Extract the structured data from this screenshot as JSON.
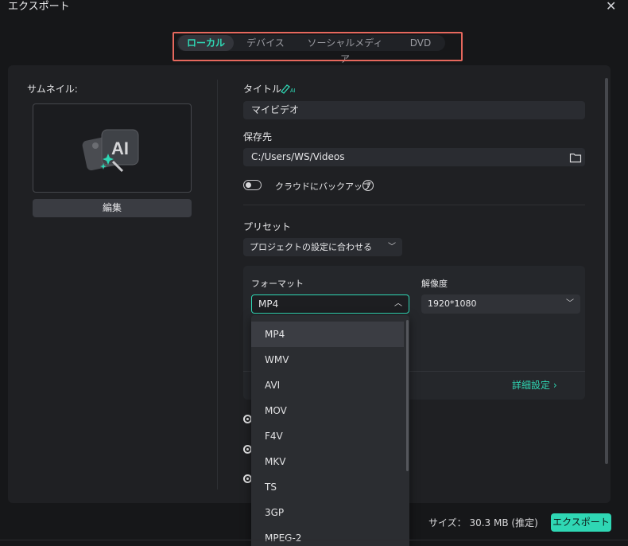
{
  "window": {
    "title": "エクスポート",
    "close": "✕"
  },
  "tabs": [
    {
      "label": "ローカル",
      "active": true
    },
    {
      "label": "デバイス",
      "active": false
    },
    {
      "label": "ソーシャルメディア",
      "active": false
    },
    {
      "label": "DVD",
      "active": false
    }
  ],
  "thumbnail": {
    "label": "サムネイル:",
    "edit_label": "編集"
  },
  "title_field": {
    "label": "タイトル",
    "ai_badge": "AI",
    "value": "マイビデオ"
  },
  "save_to": {
    "label": "保存先",
    "value": "C:/Users/WS/Videos"
  },
  "cloud": {
    "label": "クラウドにバックアップ",
    "help": "?"
  },
  "preset": {
    "label": "プリセット",
    "value": "プロジェクトの設定に合わせる"
  },
  "format": {
    "label": "フォーマット",
    "value": "MP4",
    "options": [
      "MP4",
      "WMV",
      "AVI",
      "MOV",
      "F4V",
      "MKV",
      "TS",
      "3GP",
      "MPEG-2"
    ]
  },
  "resolution": {
    "label": "解像度",
    "value": "1920*1080"
  },
  "advanced": {
    "label": "詳細設定 ›"
  },
  "footer": {
    "size_text": "サイズ： 30.3 MB (推定)",
    "export_label": "エクスポート"
  },
  "colors": {
    "accent": "#2fd7b4",
    "highlight_border": "#e6685d",
    "panel": "#1f2023"
  }
}
